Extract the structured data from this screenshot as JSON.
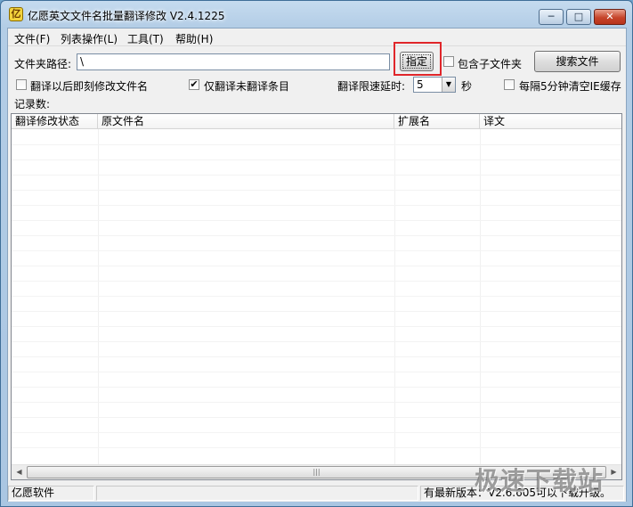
{
  "window": {
    "title": "亿愿英文文件名批量翻译修改 V2.4.1225",
    "app_icon_glyph": "亿",
    "controls": {
      "minimize": "─",
      "maximize": "□",
      "close": "✕"
    }
  },
  "menu": {
    "items": [
      {
        "label": "文件(F)"
      },
      {
        "label": "列表操作(L)"
      },
      {
        "label": "工具(T)"
      },
      {
        "label": "帮助(H)"
      }
    ]
  },
  "folder": {
    "label": "文件夹路径:",
    "value": "\\",
    "set_button": "指定",
    "include_subfolders": {
      "label": "包含子文件夹",
      "checked": false
    },
    "search_button": "搜索文件"
  },
  "options": {
    "rename_after_translate": {
      "label": "翻译以后即刻修改文件名",
      "checked": false
    },
    "only_untranslated": {
      "label": "仅翻译未翻译条目",
      "checked": true,
      "mark": "✔"
    },
    "delay_label": "翻译限速延时:",
    "delay_value": "5",
    "delay_unit": "秒",
    "clear_ie_cache": {
      "label": "每隔5分钟清空IE缓存",
      "checked": false
    }
  },
  "records_label": "记录数:",
  "table": {
    "columns": [
      "翻译修改状态",
      "原文件名",
      "扩展名",
      "译文"
    ],
    "rows": []
  },
  "statusbar": {
    "left": "亿愿软件",
    "middle": "",
    "right": "有最新版本：V2.6.605可以下载升级。"
  },
  "watermark": "极速下载站"
}
